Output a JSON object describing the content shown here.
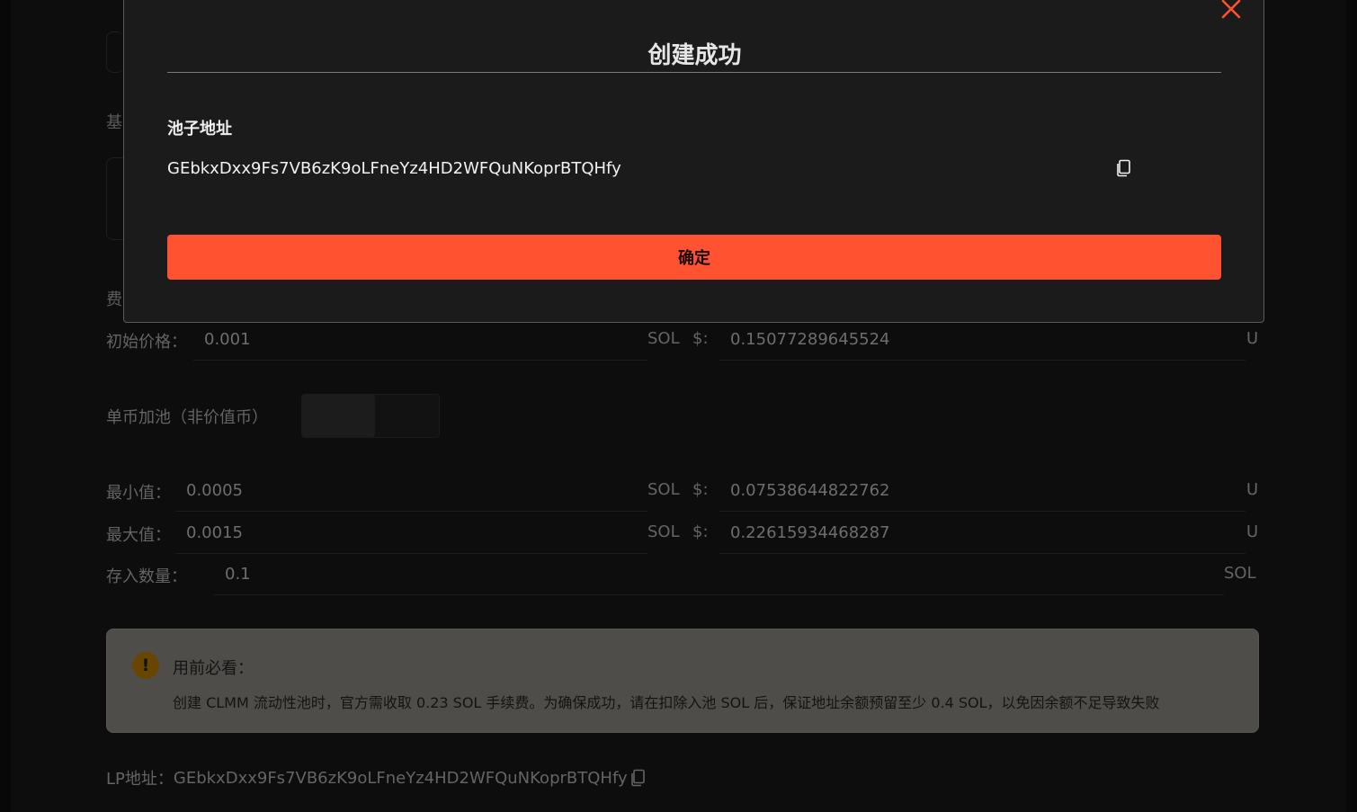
{
  "dialog": {
    "title": "创建成功",
    "pool_label": "池子地址",
    "pool_address": "GEbkxDxx9Fs7VB6zK9oLFneYz4HD2WFQuNKoprBTQHfy",
    "confirm_label": "确定"
  },
  "form": {
    "ghost_labels": [
      "基",
      "费"
    ],
    "initial_price": {
      "label": "初始价格：",
      "value": "0.001",
      "unit": "SOL",
      "usd_label": "$:",
      "usd_value": "0.15077289645524",
      "usd_unit": "U"
    },
    "single_side": {
      "label": "单币加池（非价值币）",
      "enabled": false
    },
    "min": {
      "label": "最小值：",
      "value": "0.0005",
      "unit": "SOL",
      "usd_label": "$:",
      "usd_value": "0.07538644822762",
      "usd_unit": "U"
    },
    "max": {
      "label": "最大值：",
      "value": "0.0015",
      "unit": "SOL",
      "usd_label": "$:",
      "usd_value": "0.22615934468287",
      "usd_unit": "U"
    },
    "deposit": {
      "label": "存入数量：",
      "value": "0.1",
      "unit": "SOL"
    }
  },
  "notice": {
    "icon": "warning-icon",
    "title": "用前必看：",
    "text": "创建 CLMM 流动性池时，官方需收取 0.23 SOL 手续费。为确保成功，请在扣除入池 SOL 后，保证地址余额预留至少 0.4 SOL，以免因余额不足导致失败"
  },
  "lp": {
    "label": "LP地址：",
    "address": "GEbkxDxx9Fs7VB6zK9oLFneYz4HD2WFQuNKoprBTQHfy"
  },
  "colors": {
    "accent": "#ff5230",
    "close": "#ff5230",
    "notice_bg": "#7a7770",
    "warning": "#a06c04"
  }
}
